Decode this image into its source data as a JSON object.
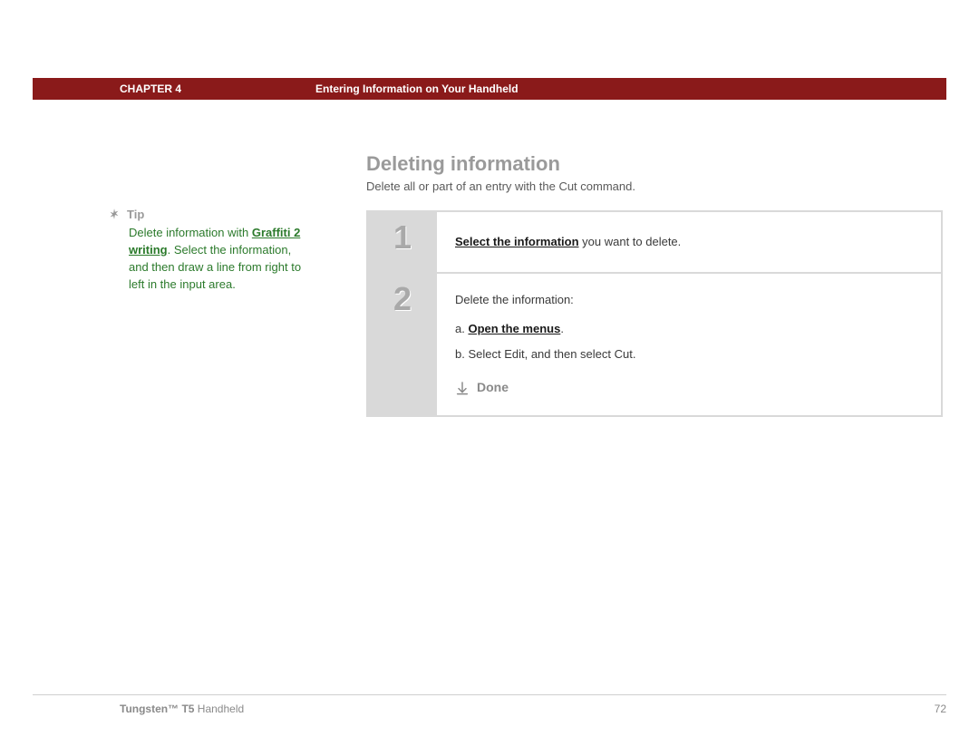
{
  "header": {
    "chapter": "CHAPTER 4",
    "title": "Entering Information on Your Handheld"
  },
  "section": {
    "heading": "Deleting information",
    "sub": "Delete all or part of an entry with the Cut command."
  },
  "tip": {
    "label": "Tip",
    "pre": "Delete information with ",
    "link": "Graffiti 2 writing",
    "post": ". Select the information, and then draw a line from right to left in the input area."
  },
  "steps": {
    "one": {
      "num": "1",
      "link": "Select the information",
      "rest": " you want to delete."
    },
    "two": {
      "num": "2",
      "intro": "Delete the information:",
      "a_prefix": "a.  ",
      "a_link": "Open the menus",
      "a_suffix": ".",
      "b": "b.  Select Edit, and then select Cut.",
      "done": "Done"
    }
  },
  "footer": {
    "product_bold": "Tungsten™ T5",
    "product_rest": " Handheld",
    "page": "72"
  }
}
